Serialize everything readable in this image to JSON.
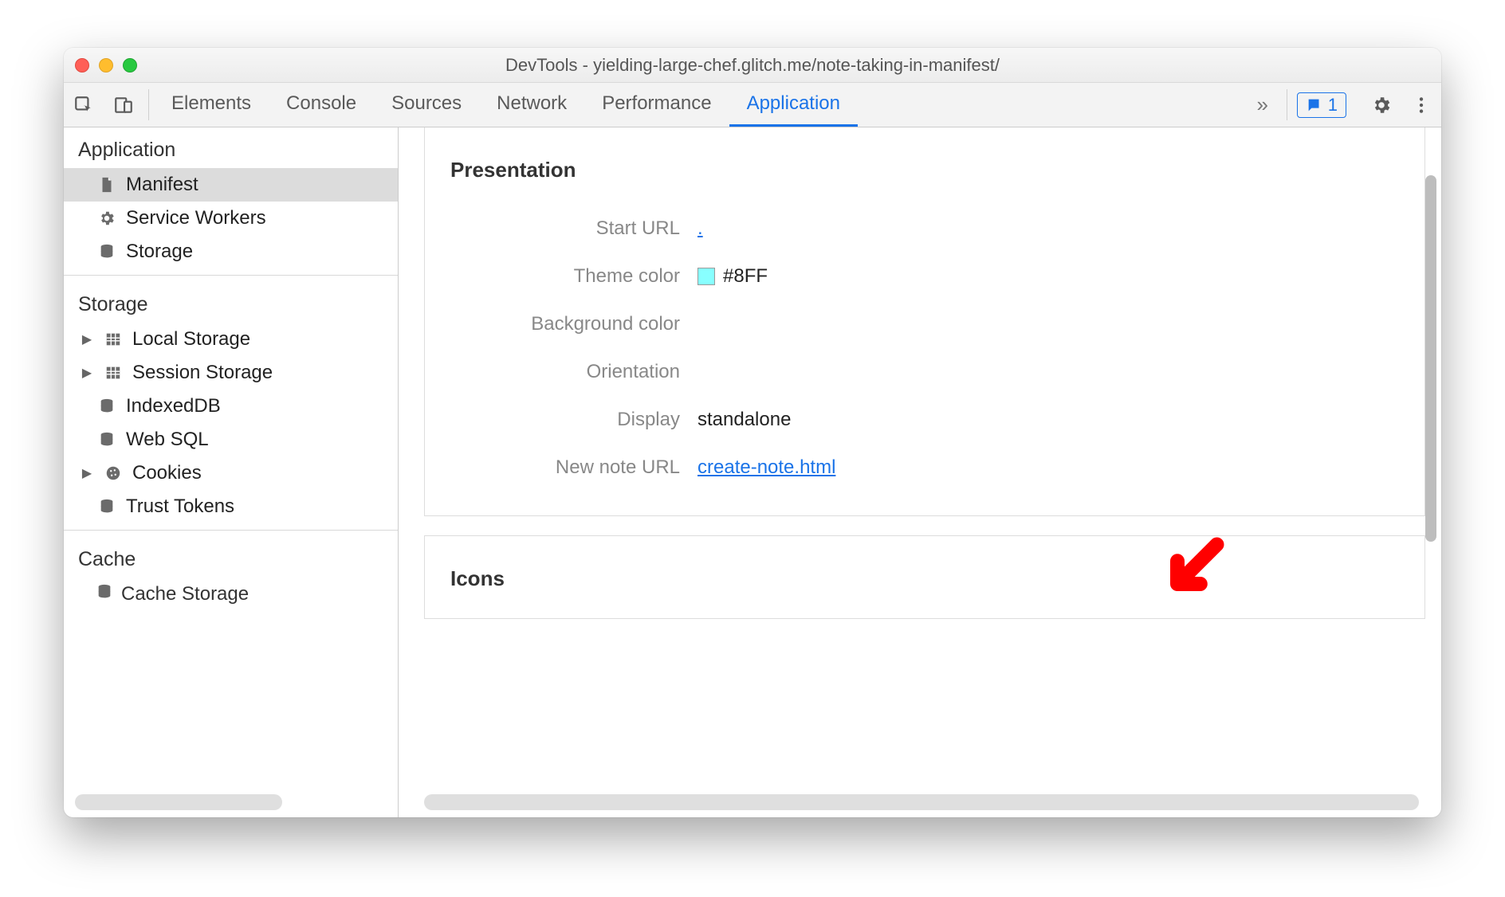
{
  "window": {
    "title": "DevTools - yielding-large-chef.glitch.me/note-taking-in-manifest/"
  },
  "toolbar": {
    "tabs": [
      "Elements",
      "Console",
      "Sources",
      "Network",
      "Performance",
      "Application"
    ],
    "active_tab": "Application",
    "more_indicator": "»",
    "issue_count": "1"
  },
  "sidebar": {
    "sections": {
      "application": {
        "title": "Application",
        "items": [
          "Manifest",
          "Service Workers",
          "Storage"
        ],
        "selected": "Manifest"
      },
      "storage": {
        "title": "Storage",
        "items": [
          "Local Storage",
          "Session Storage",
          "IndexedDB",
          "Web SQL",
          "Cookies",
          "Trust Tokens"
        ]
      },
      "cache": {
        "title": "Cache",
        "items": [
          "Cache Storage"
        ]
      }
    }
  },
  "content": {
    "presentation": {
      "title": "Presentation",
      "rows": {
        "start_url": {
          "label": "Start URL",
          "value": "."
        },
        "theme_color": {
          "label": "Theme color",
          "value": "#8FF"
        },
        "background_color": {
          "label": "Background color",
          "value": ""
        },
        "orientation": {
          "label": "Orientation",
          "value": ""
        },
        "display": {
          "label": "Display",
          "value": "standalone"
        },
        "new_note_url": {
          "label": "New note URL",
          "value": "create-note.html"
        }
      }
    },
    "icons": {
      "title": "Icons"
    }
  }
}
